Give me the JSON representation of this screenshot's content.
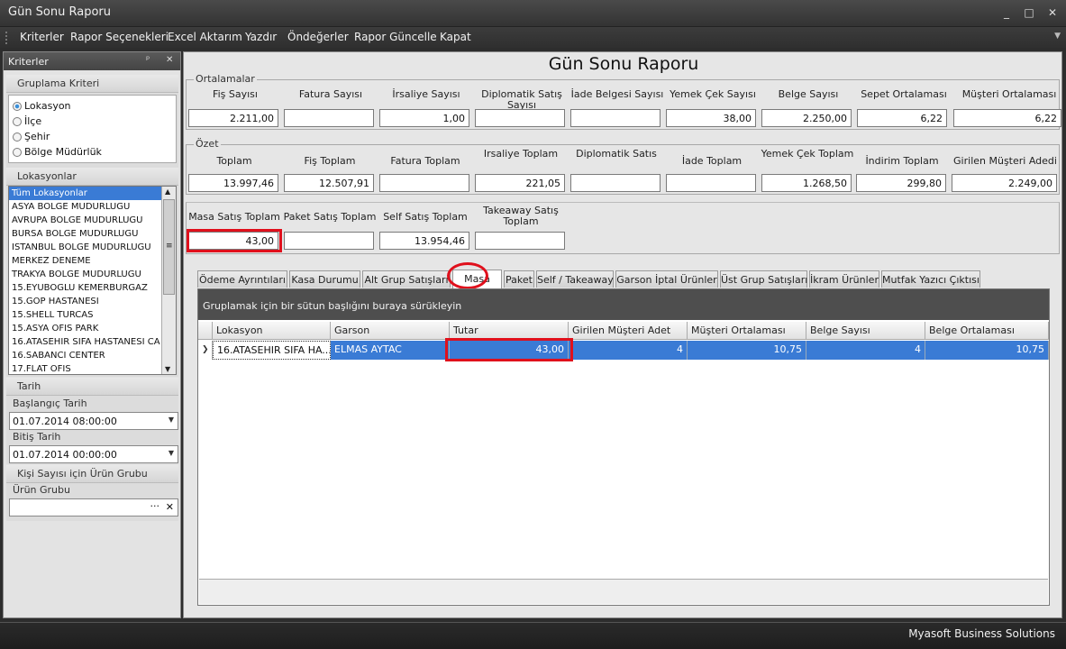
{
  "window": {
    "title": "Gün Sonu Raporu",
    "minimize": "_",
    "restore": "□",
    "close": "✕"
  },
  "menu": [
    "Kriterler",
    "Rapor Seçenekleri",
    "Excel Aktarım",
    "Yazdır",
    "Öndeğerler",
    "Rapor Güncelle",
    "Kapat"
  ],
  "sidebar": {
    "title": "Kriterler",
    "pin": "ᵖ",
    "close": "✕",
    "grouping": {
      "title": "Gruplama Kriteri",
      "options": [
        "Lokasyon",
        "İlçe",
        "Şehir",
        "Bölge Müdürlük"
      ],
      "selected": "Lokasyon"
    },
    "locations": {
      "title": "Lokasyonlar",
      "items": [
        "Tüm Lokasyonlar",
        "ASYA BOLGE MUDURLUGU",
        "AVRUPA BOLGE MUDURLUGU",
        "BURSA BOLGE MUDURLUGU",
        "ISTANBUL BOLGE MUDURLUGU",
        "MERKEZ DENEME",
        "TRAKYA BOLGE MUDURLUGU",
        "15.EYUBOGLU KEMERBURGAZ",
        "15.GOP HASTANESI",
        "15.SHELL TURCAS",
        "15.ASYA OFIS PARK",
        "16.ATASEHIR SIFA HASTANESI CA",
        "16.SABANCI CENTER",
        "17.FLAT OFIS"
      ],
      "selected_index": 0
    },
    "date": {
      "title": "Tarih",
      "start_label": "Başlangıç Tarih",
      "start_value": "01.07.2014 08:00:00",
      "end_label": "Bitiş Tarih",
      "end_value": "01.07.2014 00:00:00"
    },
    "product": {
      "title": "Kişi Sayısı için Ürün Grubu",
      "label": "Ürün Grubu",
      "value": "",
      "ellipsis": "···",
      "clear": "✕"
    }
  },
  "report": {
    "title": "Gün Sonu Raporu",
    "averages": {
      "legend": "Ortalamalar",
      "fields": [
        {
          "label": "Fiş Sayısı",
          "value": "2.211,00"
        },
        {
          "label": "Fatura Sayısı",
          "value": ""
        },
        {
          "label": "İrsaliye Sayısı",
          "value": "1,00"
        },
        {
          "label": "Diplomatik Satış Sayısı",
          "value": ""
        },
        {
          "label": "İade Belgesi Sayısı",
          "value": ""
        },
        {
          "label": "Yemek Çek Sayısı",
          "value": "38,00"
        },
        {
          "label": "Belge Sayısı",
          "value": "2.250,00"
        },
        {
          "label": "Sepet Ortalaması",
          "value": "6,22"
        },
        {
          "label": "Müşteri Ortalaması",
          "value": "6,22"
        }
      ]
    },
    "summary": {
      "legend": "Özet",
      "fields": [
        {
          "label": "Toplam",
          "value": "13.997,46"
        },
        {
          "label": "Fiş Toplam",
          "value": "12.507,91"
        },
        {
          "label": "Fatura Toplam",
          "value": ""
        },
        {
          "label": "Irsaliye Toplam",
          "value": "221,05"
        },
        {
          "label": "Diplomatik Satıs",
          "value": ""
        },
        {
          "label": "İade Toplam",
          "value": ""
        },
        {
          "label": "Yemek Çek Toplam",
          "value": "1.268,50"
        },
        {
          "label": "İndirim Toplam",
          "value": "299,80"
        },
        {
          "label": "Girilen Müşteri Adedi",
          "value": "2.249,00"
        }
      ]
    },
    "sales": [
      {
        "label": "Masa Satış Toplam",
        "value": "43,00"
      },
      {
        "label": "Paket Satış Toplam",
        "value": ""
      },
      {
        "label": "Self Satış Toplam",
        "value": "13.954,46"
      },
      {
        "label": "Takeaway Satış Toplam",
        "value": ""
      }
    ],
    "tabs": [
      "Ödeme Ayrıntıları",
      "Kasa Durumu",
      "Alt Grup Satışları",
      "Masa",
      "Paket",
      "Self / Takeaway",
      "Garson İptal Ürünler",
      "Üst Grup Satışları",
      "İkram Ürünler",
      "Mutfak Yazıcı Çıktısı"
    ],
    "active_tab": "Masa",
    "grid": {
      "group_hint": "Gruplamak için bir sütun başlığını buraya sürükleyin",
      "columns": [
        "Lokasyon",
        "Garson",
        "Tutar",
        "Girilen Müşteri Adet",
        "Müşteri Ortalaması",
        "Belge Sayısı",
        "Belge Ortalaması"
      ],
      "rows": [
        {
          "lokasyon": "16.ATASEHIR SIFA HA...",
          "garson": "ELMAS AYTAC",
          "tutar": "43,00",
          "musteri_adet": "4",
          "musteri_ort": "10,75",
          "belge_sayisi": "4",
          "belge_ort": "10,75"
        }
      ],
      "row_indicator": "❯"
    }
  },
  "status": {
    "text": "Myasoft Business Solutions"
  },
  "colors": {
    "highlight_red": "#e0101c",
    "selection_blue": "#3a7bd5"
  }
}
